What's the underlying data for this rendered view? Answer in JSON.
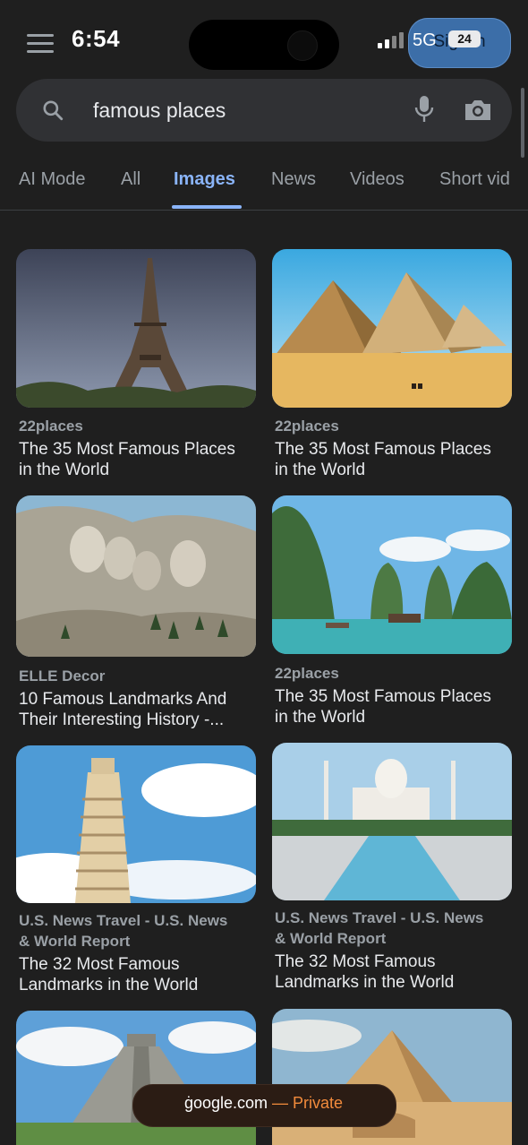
{
  "status": {
    "time": "6:54",
    "network": "5G",
    "battery": "24"
  },
  "header": {
    "signin_label": "Sign in"
  },
  "search": {
    "query": "famous places"
  },
  "tabs": [
    "AI Mode",
    "All",
    "Images",
    "News",
    "Videos",
    "Short vid"
  ],
  "active_tab": "Images",
  "results": [
    {
      "source": "22places",
      "title_l1": "The 35 Most Famous Places",
      "title_l2": "in the World",
      "image": "eiffel-tower"
    },
    {
      "source": "22places",
      "title_l1": "The 35 Most Famous Places",
      "title_l2": "in the World",
      "image": "giza-pyramids"
    },
    {
      "source": "ELLE Decor",
      "title_l1": "10 Famous Landmarks And",
      "title_l2": "Their Interesting History -...",
      "image": "mount-rushmore"
    },
    {
      "source": "22places",
      "title_l1": "The 35 Most Famous Places",
      "title_l2": "in the World",
      "image": "ha-long-bay"
    },
    {
      "source_l1": "U.S. News Travel - U.S. News",
      "source_l2": "& World Report",
      "title_l1": "The 32 Most Famous",
      "title_l2": "Landmarks in the World",
      "image": "leaning-tower-of-pisa"
    },
    {
      "source_l1": "U.S. News Travel - U.S. News",
      "source_l2": "& World Report",
      "title_l1": "The 32 Most Famous",
      "title_l2": "Landmarks in the World",
      "image": "taj-mahal"
    },
    {
      "image": "chichen-itza"
    },
    {
      "image": "giza-sphinx"
    }
  ],
  "footer": {
    "domain": "ġoogle.com",
    "separator": " — ",
    "mode": "Private"
  },
  "colors": {
    "background": "#1f1f1f",
    "accent": "#8ab4f8",
    "private": "#f28b3c"
  }
}
